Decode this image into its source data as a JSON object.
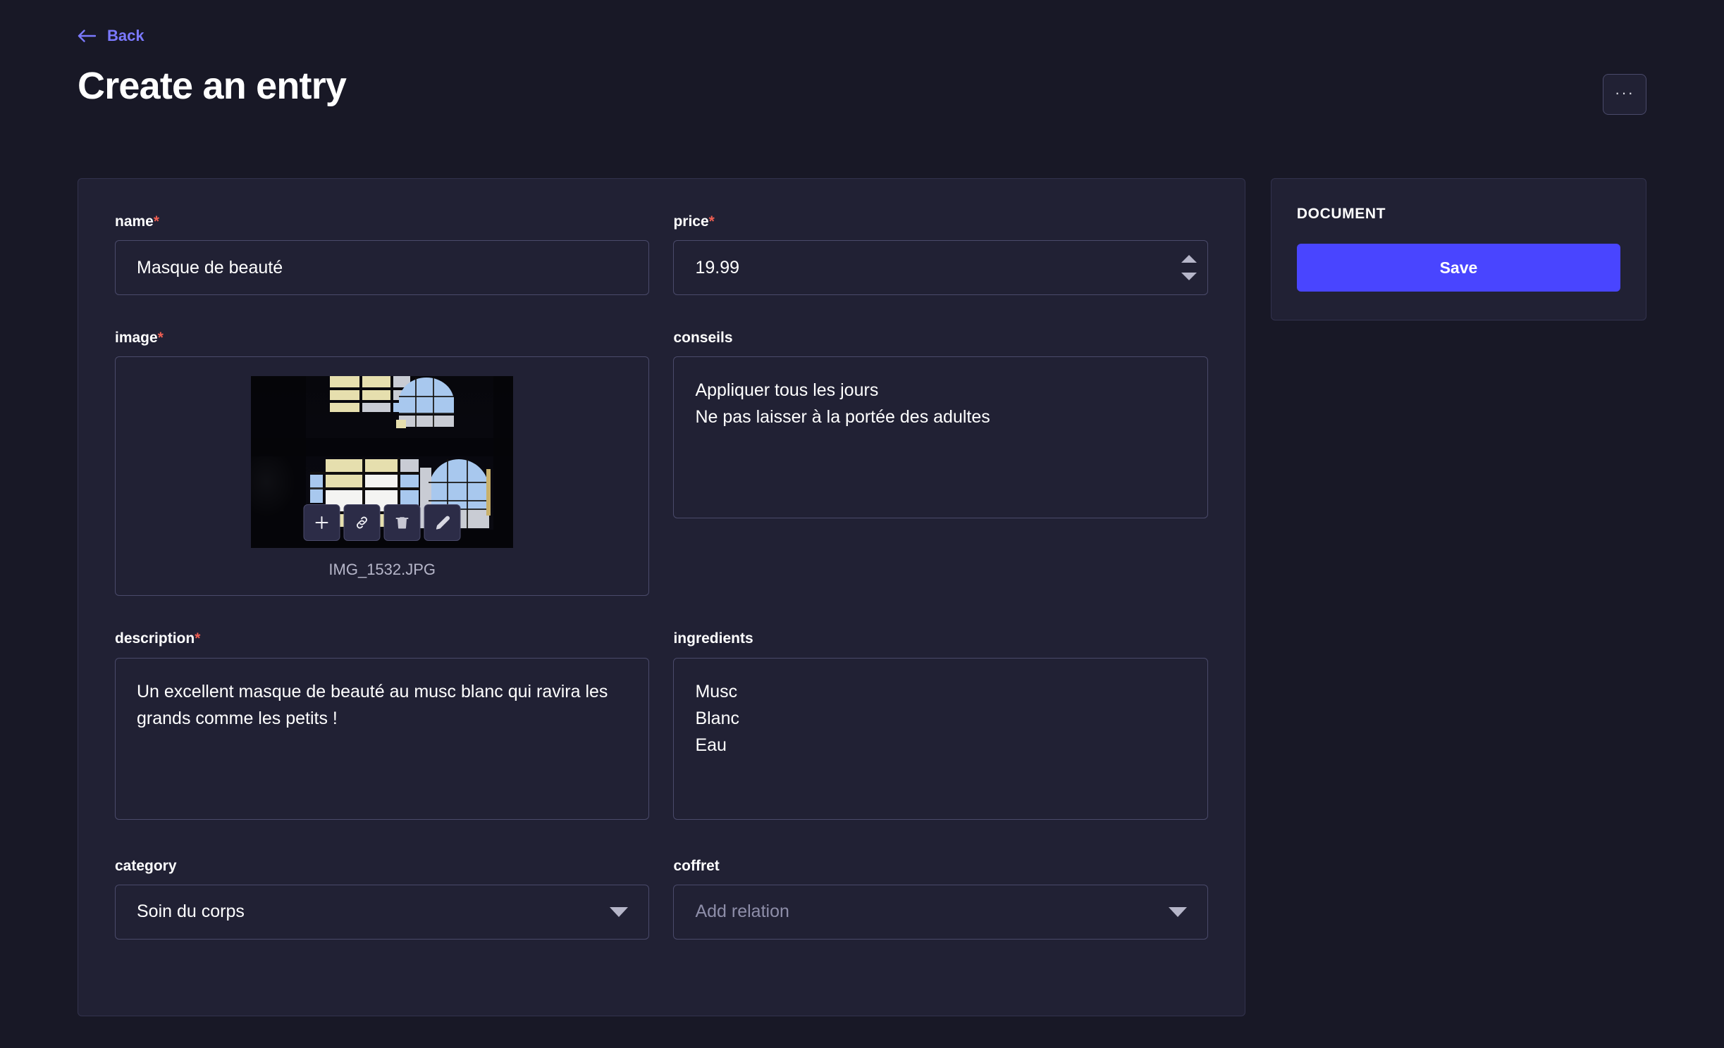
{
  "header": {
    "back_label": "Back",
    "back_icon": "arrow-left-icon",
    "title": "Create an entry",
    "more_label": "···",
    "more_icon": "ellipsis-icon"
  },
  "form": {
    "fields": {
      "name": {
        "label": "name",
        "required_marker": "*",
        "value": "Masque de beauté",
        "placeholder": ""
      },
      "price": {
        "label": "price",
        "required_marker": "*",
        "value": "19.99",
        "placeholder": ""
      },
      "image": {
        "label": "image",
        "required_marker": "*",
        "file_name": "IMG_1532.JPG",
        "actions": [
          {
            "name": "add-asset-button",
            "icon": "plus-icon"
          },
          {
            "name": "copy-link-button",
            "icon": "link-icon"
          },
          {
            "name": "delete-asset-button",
            "icon": "trash-icon"
          },
          {
            "name": "edit-asset-button",
            "icon": "pencil-icon"
          }
        ]
      },
      "conseils": {
        "label": "conseils",
        "required_marker": "",
        "value": "Appliquer tous les jours\nNe pas laisser à la portée des adultes",
        "placeholder": ""
      },
      "description": {
        "label": "description",
        "required_marker": "*",
        "value": "Un excellent masque de beauté au musc blanc qui ravira les grands comme les petits !",
        "placeholder": ""
      },
      "ingredients": {
        "label": "ingredients",
        "required_marker": "",
        "value": "Musc\nBlanc\nEau",
        "placeholder": ""
      },
      "category": {
        "label": "category",
        "required_marker": "",
        "value": "Soin du corps",
        "placeholder": "",
        "caret_icon": "chevron-down-icon"
      },
      "coffret": {
        "label": "coffret",
        "required_marker": "",
        "value": "",
        "placeholder": "Add relation",
        "caret_icon": "chevron-down-icon"
      }
    }
  },
  "sidebar": {
    "section_title": "DOCUMENT",
    "save_label": "Save"
  },
  "colors": {
    "background": "#181826",
    "panel": "#212134",
    "panel_border": "#32324d",
    "input_border": "#4a4a6a",
    "accent": "#4945ff",
    "link": "#7b79ff",
    "required": "#ee5e52",
    "muted_text": "#8e8ea9",
    "text": "#ffffff"
  }
}
